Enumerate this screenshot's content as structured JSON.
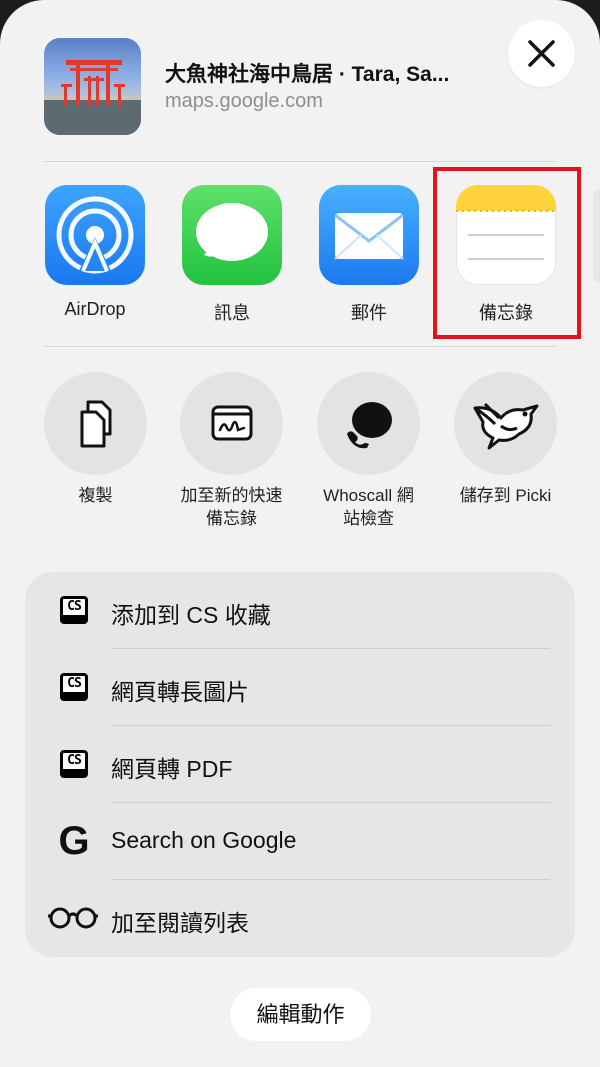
{
  "header": {
    "title": "大魚神社海中鳥居 · Tara, Sa...",
    "subtitle": "maps.google.com"
  },
  "apps": [
    {
      "label": "AirDrop",
      "icon": "airdrop-icon"
    },
    {
      "label": "訊息",
      "icon": "messages-icon"
    },
    {
      "label": "郵件",
      "icon": "mail-icon"
    },
    {
      "label": "備忘錄",
      "icon": "notes-icon",
      "highlighted": true
    }
  ],
  "actions": [
    {
      "label": "複製",
      "icon": "copy-icon"
    },
    {
      "label": "加至新的快速\n備忘錄",
      "icon": "quick-note-icon"
    },
    {
      "label": "Whoscall 網\n站檢查",
      "icon": "whoscall-icon"
    },
    {
      "label": "儲存到 Picki",
      "icon": "bird-icon"
    }
  ],
  "list": [
    {
      "label": "添加到 CS 收藏",
      "icon": "cs-icon"
    },
    {
      "label": "網頁轉長圖片",
      "icon": "cs-icon"
    },
    {
      "label": "網頁轉 PDF",
      "icon": "cs-icon"
    },
    {
      "label": "Search on Google",
      "icon": "google-icon"
    },
    {
      "label": "加至閱讀列表",
      "icon": "glasses-icon"
    }
  ],
  "cs_icon_text": "CS",
  "google_icon_text": "G",
  "edit_actions_label": "編輯動作",
  "colors": {
    "highlight": "#e2141b",
    "airdrop": "#1a8cff",
    "messages": "#2ec94f",
    "mail": "#2b8ff5",
    "notes_yellow": "#ffd33c"
  }
}
